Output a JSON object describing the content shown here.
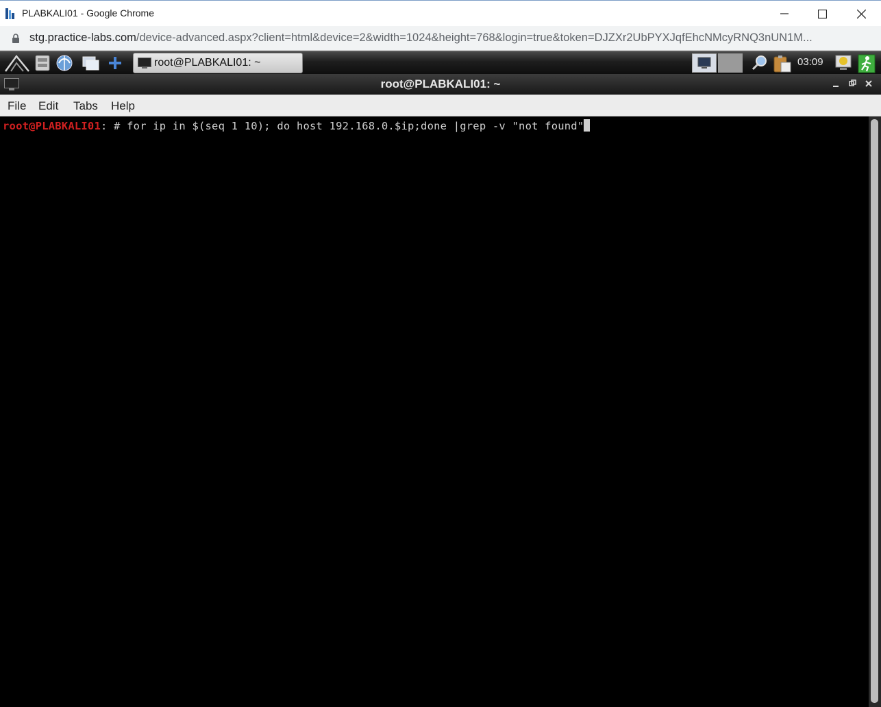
{
  "browser": {
    "window_title": "PLABKALI01 - Google Chrome",
    "url_host": "stg.practice-labs.com",
    "url_rest": "/device-advanced.aspx?client=html&device=2&width=1024&height=768&login=true&token=DJZXr2UbPYXJqfEhcNMcyRNQ3nUN1M..."
  },
  "panel": {
    "taskbar_label": "root@PLABKALI01: ~",
    "clock": "03:09"
  },
  "terminal": {
    "title": "root@PLABKALI01: ~",
    "menu": [
      "File",
      "Edit",
      "Tabs",
      "Help"
    ],
    "prompt_user": "root@PLABKALI01",
    "prompt_suffix": ": # ",
    "command": "for ip in $(seq 1 10); do host 192.168.0.$ip;done |grep -v \"not found\""
  },
  "colors": {
    "prompt": "#d02020",
    "terminal_bg": "#000000",
    "terminal_fg": "#cfcfcf"
  }
}
